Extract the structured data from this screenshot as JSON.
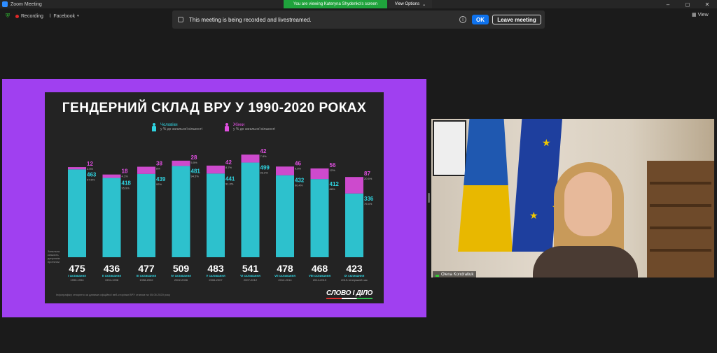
{
  "window": {
    "title": "Zoom Meeting",
    "share_banner": "You are viewing Kateryna Shydenko's screen",
    "view_options": "View Options",
    "controls": {
      "minimize": "–",
      "maximize": "◻",
      "close": "✕"
    }
  },
  "toolbar": {
    "recording_label": "Recording",
    "livestream_label": "Facebook",
    "view_label": "View"
  },
  "notice": {
    "message": "This meeting is being recorded and livestreamed.",
    "ok_label": "OK",
    "leave_label": "Leave meeting"
  },
  "slide": {
    "title": "ГЕНДЕРНИЙ СКЛАД ВРУ У 1990-2020 РОКАХ",
    "legend_men": "Чоловіки",
    "legend_men_sub": "у % до загальної кількості",
    "legend_women": "Жінки",
    "legend_women_sub": "у % до загальної кількості",
    "side_note": "Загальна кількість депутатів протягом",
    "footnote": "Інфографіку створено за даними офіційної веб-сторінки ВРУ станом на 05.05.2020 року",
    "logo": "СЛОВО І ДІЛО",
    "colors": {
      "men": "#2fd3e0",
      "women": "#e04fe0",
      "background": "#232323",
      "frame": "#a040f0"
    }
  },
  "chart_data": {
    "type": "bar",
    "categories": [
      "I скликання",
      "II скликання",
      "III скликання",
      "IV скликання",
      "V скликання",
      "VI скликання",
      "VII скликання",
      "VIII скликання",
      "IX скликання"
    ],
    "years": [
      "1990-1994",
      "1994-1998",
      "1998-2002",
      "2002-2006",
      "2006-2007",
      "2007-2012",
      "2012-2014",
      "2014-2019",
      "2019-теперішній час"
    ],
    "totals": [
      475,
      436,
      477,
      509,
      483,
      541,
      478,
      468,
      423
    ],
    "series": [
      {
        "name": "Чоловіки",
        "values": [
          463,
          418,
          439,
          481,
          441,
          499,
          432,
          412,
          336
        ],
        "percent": [
          "97.5%",
          "95.9%",
          "92%",
          "94.5%",
          "91.3%",
          "92.2%",
          "90.4%",
          "88%",
          "79.4%"
        ]
      },
      {
        "name": "Жінки",
        "values": [
          12,
          18,
          38,
          28,
          42,
          42,
          46,
          56,
          87
        ],
        "percent": [
          "2.5%",
          "4.1%",
          "8%",
          "5.5%",
          "8.7%",
          "7.8%",
          "9.6%",
          "12%",
          "20.6%"
        ]
      }
    ],
    "ylim": [
      0,
      560
    ]
  },
  "participant": {
    "name": "Olena Kondratiuk"
  }
}
